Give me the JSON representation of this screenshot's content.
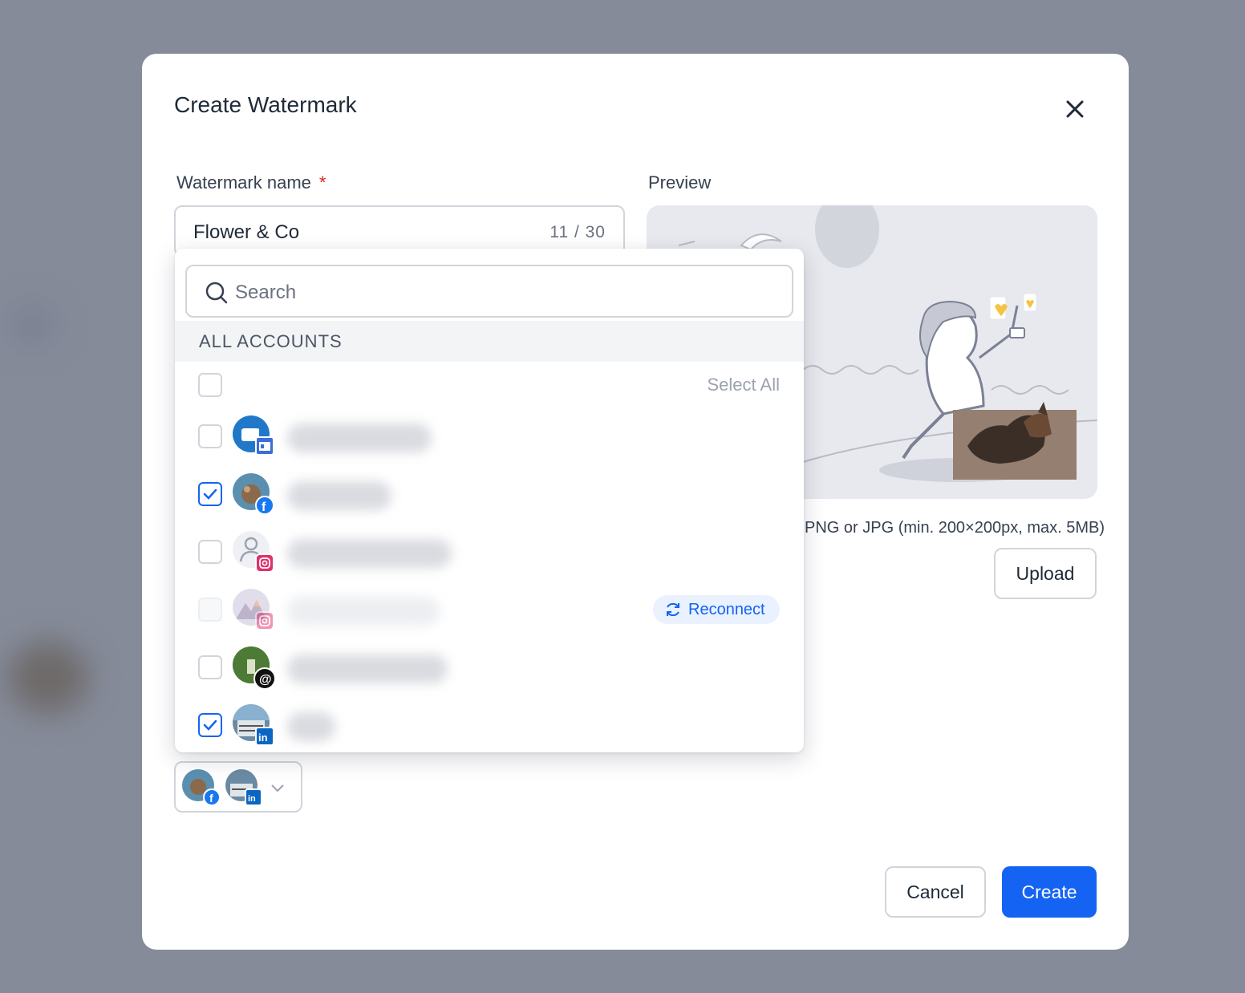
{
  "modal": {
    "title": "Create Watermark",
    "name_label": "Watermark name",
    "required_mark": "*",
    "name_value": "Flower & Co",
    "name_counter": "11 / 30",
    "preview_label": "Preview",
    "upload_hint": "PNG or JPG (min. 200×200px, max. 5MB)",
    "upload_label": "Upload",
    "cancel_label": "Cancel",
    "create_label": "Create"
  },
  "dropdown": {
    "search_placeholder": "Search",
    "group_header": "ALL ACCOUNTS",
    "select_all_label": "Select All",
    "reconnect_label": "Reconnect",
    "accounts": [
      {
        "platform": "google-business",
        "checked": false,
        "disabled": false,
        "needs_reconnect": false
      },
      {
        "platform": "facebook",
        "checked": true,
        "disabled": false,
        "needs_reconnect": false
      },
      {
        "platform": "instagram",
        "checked": false,
        "disabled": false,
        "needs_reconnect": false
      },
      {
        "platform": "instagram",
        "checked": false,
        "disabled": true,
        "needs_reconnect": true
      },
      {
        "platform": "threads",
        "checked": false,
        "disabled": false,
        "needs_reconnect": false
      },
      {
        "platform": "linkedin",
        "checked": true,
        "disabled": false,
        "needs_reconnect": false
      }
    ]
  },
  "selected_accounts": [
    "facebook",
    "linkedin"
  ],
  "colors": {
    "primary": "#1463f3",
    "overlay": "#858b99",
    "facebook": "#1877f2",
    "linkedin": "#0a66c2",
    "instagram": "#e1306c",
    "heart": "#f6c343"
  },
  "icons": [
    "close-icon",
    "search-icon",
    "check-icon",
    "reconnect-icon",
    "chevron-down-icon",
    "facebook-icon",
    "instagram-icon",
    "linkedin-icon",
    "threads-icon",
    "google-business-icon",
    "user-placeholder-icon"
  ]
}
